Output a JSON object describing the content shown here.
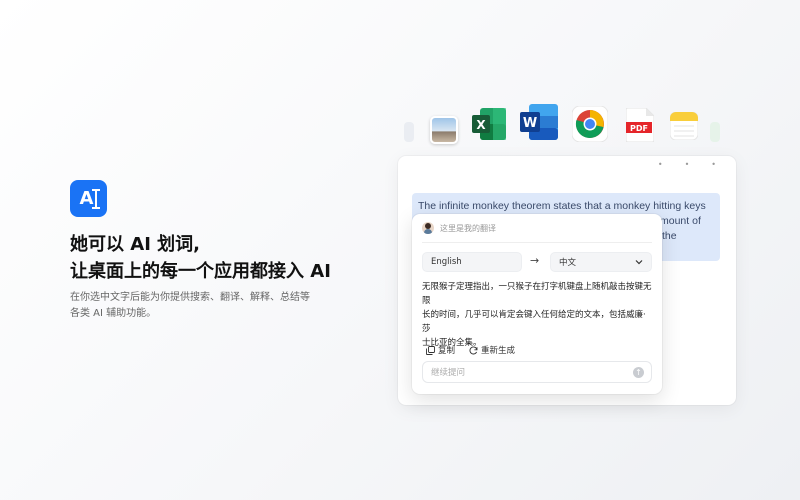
{
  "promo": {
    "logo_text": "A",
    "headline_line1": "她可以 AI 划词,",
    "headline_line2": "让桌面上的每一个应用都接入 AI",
    "subtext_line1": "在你选中文字后能为你提供搜索、翻译、解释、总结等",
    "subtext_line2": "各类 AI 辅助功能。"
  },
  "dock": {
    "icons": [
      "preview-icon",
      "excel-icon",
      "word-icon",
      "chrome-icon",
      "pdf-icon",
      "notes-icon"
    ],
    "excel_letter": "X",
    "word_letter": "W",
    "pdf_label": "PDF"
  },
  "window": {
    "controls": [
      "•",
      "•",
      "•"
    ],
    "selected_text_line1": "The infinite monkey theorem states that a monkey hitting keys",
    "selected_text_line2_visible": "mount of",
    "selected_text_line3_visible": "the"
  },
  "popup": {
    "title": "这里是我的翻译",
    "source_lang": "English",
    "target_lang": "中文",
    "arrow": "→",
    "translation_line1": "无限猴子定理指出，一只猴子在打字机键盘上随机敲击按键无限",
    "translation_line2": "长的时间，几乎可以肯定会键入任何给定的文本，包括威廉·莎",
    "translation_line3": "士比亚的全集。",
    "copy_label": "复制",
    "regenerate_label": "重新生成",
    "input_placeholder": "继续提问"
  },
  "colors": {
    "brand_blue": "#1a73f5",
    "selection_bg": "#dde8fa"
  }
}
